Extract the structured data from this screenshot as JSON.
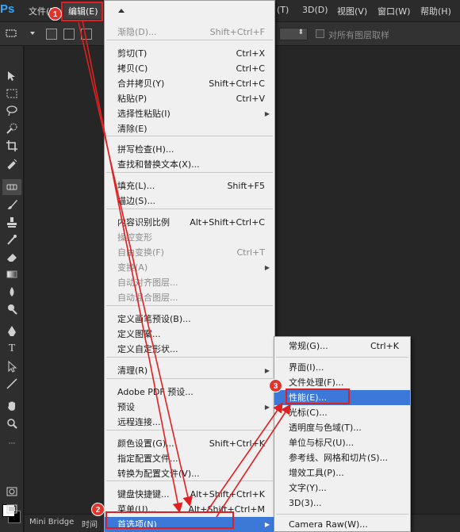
{
  "app": {
    "logo": "Ps"
  },
  "menubar": {
    "file": "文件(F)",
    "edit": "编辑(E)",
    "image": "(T)",
    "3d": "3D(D)",
    "view": "视图(V)",
    "window": "窗口(W)",
    "help": "帮助(H)"
  },
  "options": {
    "sample_all_layers": "对所有图层取样"
  },
  "edit_menu": {
    "items": [
      {
        "label": "渐隐(D)...",
        "shortcut": "Shift+Ctrl+F"
      },
      {
        "label": "剪切(T)",
        "shortcut": "Ctrl+X"
      },
      {
        "label": "拷贝(C)",
        "shortcut": "Ctrl+C"
      },
      {
        "label": "合并拷贝(Y)",
        "shortcut": "Shift+Ctrl+C"
      },
      {
        "label": "粘贴(P)",
        "shortcut": "Ctrl+V"
      },
      {
        "label": "选择性粘贴(I)",
        "shortcut": ""
      },
      {
        "label": "清除(E)",
        "shortcut": ""
      },
      {
        "label": "拼写检查(H)...",
        "shortcut": ""
      },
      {
        "label": "查找和替换文本(X)...",
        "shortcut": ""
      },
      {
        "label": "填充(L)...",
        "shortcut": "Shift+F5"
      },
      {
        "label": "描边(S)...",
        "shortcut": ""
      },
      {
        "label": "内容识别比例",
        "shortcut": "Alt+Shift+Ctrl+C"
      },
      {
        "label": "操控变形",
        "shortcut": ""
      },
      {
        "label": "自由变换(F)",
        "shortcut": "Ctrl+T"
      },
      {
        "label": "变换(A)",
        "shortcut": ""
      },
      {
        "label": "自动对齐图层...",
        "shortcut": ""
      },
      {
        "label": "自动混合图层...",
        "shortcut": ""
      },
      {
        "label": "定义画笔预设(B)...",
        "shortcut": ""
      },
      {
        "label": "定义图案...",
        "shortcut": ""
      },
      {
        "label": "定义自定形状...",
        "shortcut": ""
      },
      {
        "label": "清理(R)",
        "shortcut": ""
      },
      {
        "label": "Adobe PDF 预设...",
        "shortcut": ""
      },
      {
        "label": "预设",
        "shortcut": ""
      },
      {
        "label": "远程连接...",
        "shortcut": ""
      },
      {
        "label": "颜色设置(G)...",
        "shortcut": "Shift+Ctrl+K"
      },
      {
        "label": "指定配置文件...",
        "shortcut": ""
      },
      {
        "label": "转换为配置文件(V)...",
        "shortcut": ""
      },
      {
        "label": "键盘快捷键...",
        "shortcut": "Alt+Shift+Ctrl+K"
      },
      {
        "label": "菜单(U)...",
        "shortcut": "Alt+Shift+Ctrl+M"
      },
      {
        "label": "首选项(N)",
        "shortcut": ""
      }
    ]
  },
  "prefs_menu": {
    "items": [
      {
        "label": "常规(G)...",
        "shortcut": "Ctrl+K"
      },
      {
        "label": "界面(I)...",
        "shortcut": ""
      },
      {
        "label": "文件处理(F)...",
        "shortcut": ""
      },
      {
        "label": "性能(E)...",
        "shortcut": ""
      },
      {
        "label": "光标(C)...",
        "shortcut": ""
      },
      {
        "label": "透明度与色域(T)...",
        "shortcut": ""
      },
      {
        "label": "单位与标尺(U)...",
        "shortcut": ""
      },
      {
        "label": "参考线、网格和切片(S)...",
        "shortcut": ""
      },
      {
        "label": "增效工具(P)...",
        "shortcut": ""
      },
      {
        "label": "文字(Y)...",
        "shortcut": ""
      },
      {
        "label": "3D(3)...",
        "shortcut": ""
      },
      {
        "label": "Camera Raw(W)...",
        "shortcut": ""
      }
    ]
  },
  "bottom_tabs": {
    "bridge": "Mini Bridge",
    "timeline": "时间"
  },
  "annotations": {
    "step1": "1",
    "step2": "2",
    "step3": "3"
  },
  "colors": {
    "accent": "#3c78d8",
    "annotation": "#e02020"
  }
}
